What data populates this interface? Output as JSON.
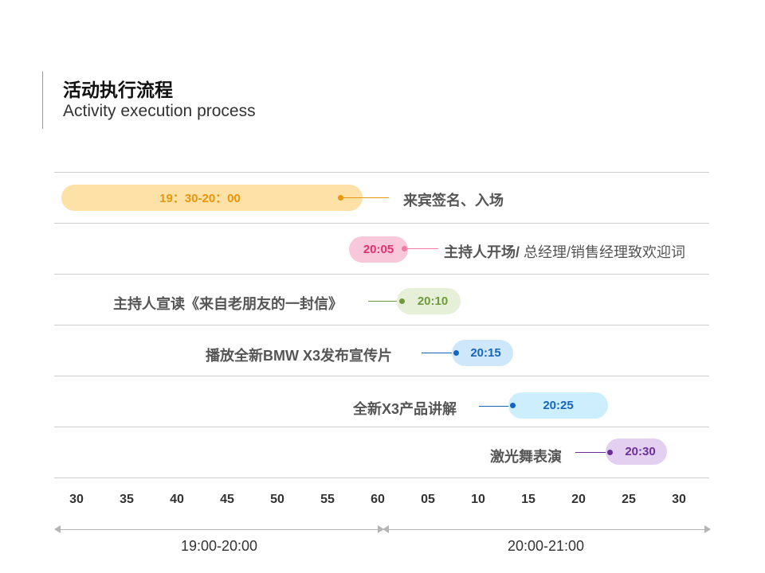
{
  "header": {
    "title": "活动执行流程",
    "subtitle": "Activity execution process"
  },
  "events": [
    {
      "time": "19：30-20：00",
      "label": "来宾签名、入场",
      "label_extra": "",
      "color": "#e8960c",
      "bg": "#fde1a6"
    },
    {
      "time": "20:05",
      "label": "主持人开场/",
      "label_extra": " 总经理/销售经理致欢迎词",
      "color": "#e0306e",
      "bg": "#f9c7da"
    },
    {
      "time": "20:10",
      "label": "主持人宣读《来自老朋友的一封信》",
      "label_extra": "",
      "color": "#6e9a3a",
      "bg": "#e6efd7"
    },
    {
      "time": "20:15",
      "label": "播放全新BMW X3发布宣传片",
      "label_extra": "",
      "color": "#1565c0",
      "bg": "#cfe7fb"
    },
    {
      "time": "20:25",
      "label": "全新X3产品讲解",
      "label_extra": "",
      "color": "#1565c0",
      "bg": "#cdeffd"
    },
    {
      "time": "20:30",
      "label": "激光舞表演",
      "label_extra": "",
      "color": "#6a2e9a",
      "bg": "#e3d0f1"
    }
  ],
  "axis": {
    "ticks": [
      "30",
      "35",
      "40",
      "45",
      "50",
      "55",
      "60",
      "05",
      "10",
      "15",
      "20",
      "25",
      "30"
    ],
    "ranges": [
      "19:00-20:00",
      "20:00-21:00"
    ]
  }
}
